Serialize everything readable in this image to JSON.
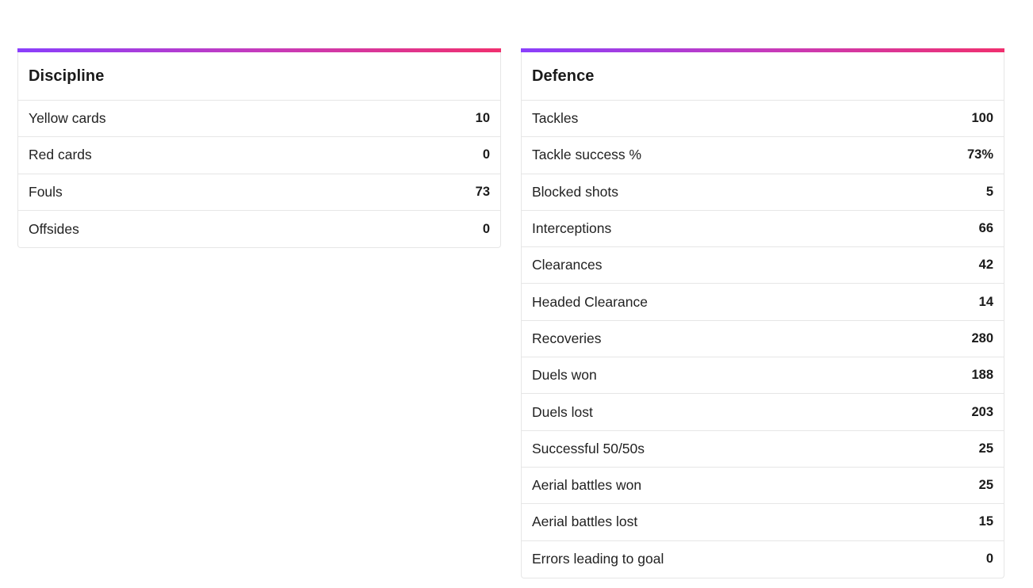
{
  "accent": {
    "gradient_start": "#8a3ffc",
    "gradient_mid": "#c53bbd",
    "gradient_end": "#f0306f"
  },
  "discipline": {
    "title": "Discipline",
    "rows": [
      {
        "label": "Yellow cards",
        "value": "10"
      },
      {
        "label": "Red cards",
        "value": "0"
      },
      {
        "label": "Fouls",
        "value": "73"
      },
      {
        "label": "Offsides",
        "value": "0"
      }
    ]
  },
  "defence": {
    "title": "Defence",
    "rows": [
      {
        "label": "Tackles",
        "value": "100"
      },
      {
        "label": "Tackle success %",
        "value": "73%"
      },
      {
        "label": "Blocked shots",
        "value": "5"
      },
      {
        "label": "Interceptions",
        "value": "66"
      },
      {
        "label": "Clearances",
        "value": "42"
      },
      {
        "label": "Headed Clearance",
        "value": "14"
      },
      {
        "label": "Recoveries",
        "value": "280"
      },
      {
        "label": "Duels won",
        "value": "188"
      },
      {
        "label": "Duels lost",
        "value": "203"
      },
      {
        "label": "Successful 50/50s",
        "value": "25"
      },
      {
        "label": "Aerial battles won",
        "value": "25"
      },
      {
        "label": "Aerial battles lost",
        "value": "15"
      },
      {
        "label": "Errors leading to goal",
        "value": "0"
      }
    ]
  }
}
